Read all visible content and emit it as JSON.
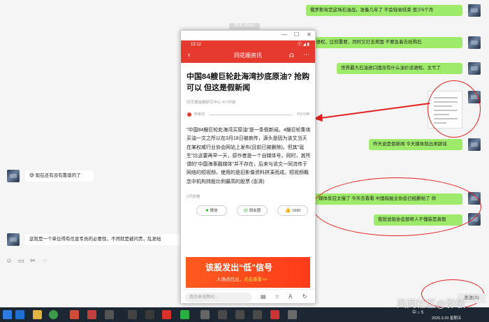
{
  "chat": {
    "timestamp": "昨天 23:01",
    "messages_right": [
      {
        "text": "俄罗斯肯定这场石油战，准备几年了  不会轻易结束  至少5个月"
      },
      {
        "text": "油价 话语权，比较重要，同时又打击美国  不要急着去抢购石"
      },
      {
        "text": "世界最大石油进口国没有什么油价话语权。太亏了"
      },
      {
        "text": "昨天说是假新闻 今天媒体就出来辟谣"
      },
      {
        "text": "媒体反应太慢了  今天去看看 中国船舶业协会已经删帖了 😅"
      },
      {
        "text": "我就说船协会那帮人不懂装是真假"
      }
    ],
    "messages_left": [
      {
        "text": "😅 现在还有没有靠谱的了"
      },
      {
        "text": "这就是一个单位得有信息专员的必要性，不然就是被问责，乱发帖"
      }
    ],
    "send_label": "发送(S)",
    "toolbar_icons": [
      "emoji-icon",
      "folder-icon",
      "scissors-icon",
      "chat-history-icon"
    ]
  },
  "phone": {
    "window_buttons": [
      "—",
      "☐",
      "✕"
    ],
    "status_time": "15:12",
    "status_icons": "ⓝ ◢ ▮",
    "app_title": "同花顺资讯",
    "headline": "中国84艘巨轮赴海湾抄底原油? 抢购可以 但这是假新闻",
    "meta": "同花顺金融研究中心  4小时前",
    "audio_label": "听新闻",
    "audio_duration": "约1分钟",
    "body": "\"中国84艘巨轮赴海湾买原油\"是一条假新闻。4艘巨轮集体买油一文之所以在3月18日被疯传，源头是因为该文当天在某权威行业协会网站上发布(目前已被删除)。但其\"诞生\"比这要再早一天，原作者是一个自媒体号。同时，其所谓的\"中国海事融媒体\"并不存在，后来与该文一同流传于网络的短视频，使用的是旧影像资料拼凑而成。短视频概念中机构持股比例最高的股票 (澎湃)",
    "time_ago": "2月前看",
    "share": {
      "wechat": "微信",
      "moments": "朋友圈",
      "likes": "1680"
    },
    "ad_title": "该股发出“低”信号",
    "ad_sub": "入场点已出，",
    "ad_link": "点击查看>>",
    "comment_placeholder": "我也来说两句..."
  },
  "watermark": "风闻社区@影敏",
  "taskbar_time": "2020.3.20 星期五",
  "taskbar_tray": "中 ♪ S"
}
